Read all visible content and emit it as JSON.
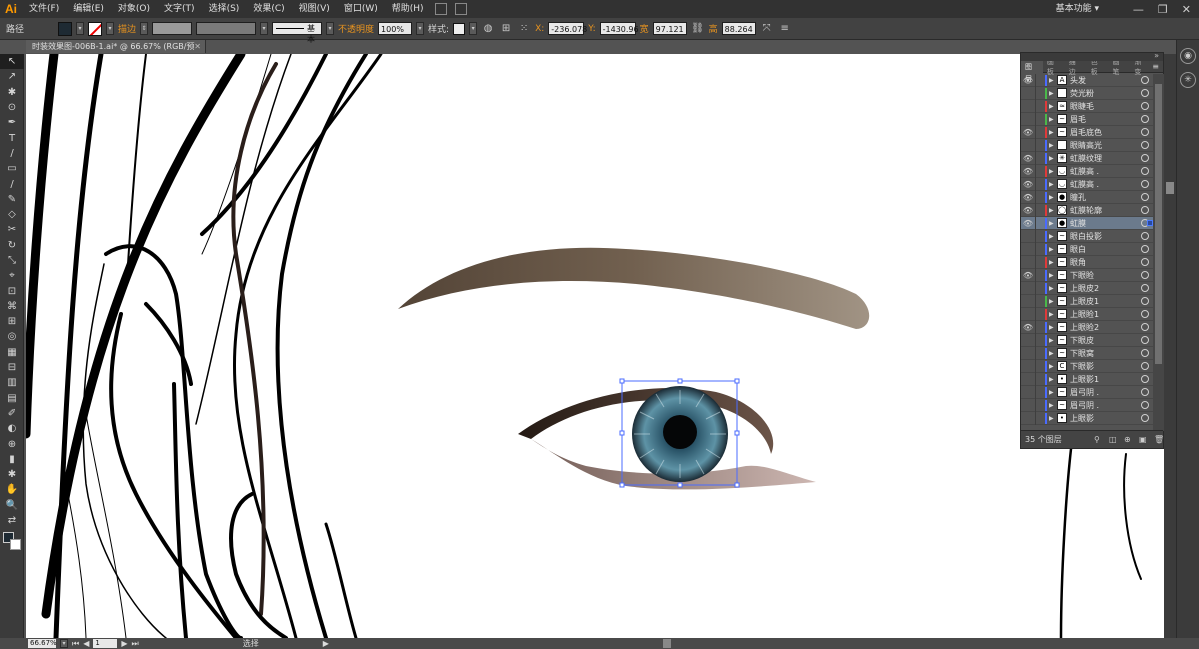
{
  "app": {
    "logo": "Ai",
    "workspace": "基本功能 ▾"
  },
  "menu": [
    "文件(F)",
    "编辑(E)",
    "对象(O)",
    "文字(T)",
    "选择(S)",
    "效果(C)",
    "视图(V)",
    "窗口(W)",
    "帮助(H)"
  ],
  "window_buttons": [
    "—",
    "❐",
    "✕"
  ],
  "control": {
    "path_label": "路径",
    "stroke_label": "描边",
    "stroke_style": "基本",
    "opacity_label": "不透明度",
    "opacity_value": "100%",
    "style_label": "样式:",
    "x_label": "X:",
    "x_value": "-236.078",
    "y_label": "Y:",
    "y_value": "-1430.96",
    "w_label": "宽",
    "w_value": "97.121 ",
    "h_label": "高",
    "h_value": "88.264 "
  },
  "document_tab": {
    "title": "时装效果图-006B-1.ai* @ 66.67% (RGB/预览)",
    "close": "✕"
  },
  "tools": [
    "↖",
    "↗",
    "✱",
    "⊙",
    "✒",
    "T",
    "/",
    "▭",
    "/",
    "✎",
    "◇",
    "✂",
    "↻",
    "⤡",
    "⌖",
    "⊡",
    "⌘",
    "⊞",
    "◎",
    "▦",
    "⊟",
    "▥",
    "▤",
    "✐",
    "◐",
    "⊕",
    "▮",
    "✱",
    "✋",
    "🔍",
    "⇄"
  ],
  "layers": {
    "tabs": [
      "图层",
      "画板",
      "描边",
      "色板",
      "画笔",
      "渐变"
    ],
    "menu_icon": "≡",
    "rows": [
      {
        "name": "头发",
        "eye": true,
        "color": "#4a6bff",
        "thumb": "A"
      },
      {
        "name": "荧光粉",
        "eye": false,
        "color": "#4ab84a",
        "thumb": ""
      },
      {
        "name": "眼睫毛",
        "eye": false,
        "color": "#e03a3a",
        "thumb": "≈"
      },
      {
        "name": "眉毛",
        "eye": false,
        "color": "#4ab84a",
        "thumb": "~"
      },
      {
        "name": "眉毛底色",
        "eye": true,
        "color": "#e03a3a",
        "thumb": "~"
      },
      {
        "name": "眼睛高光",
        "eye": false,
        "color": "#4a6bff",
        "thumb": ""
      },
      {
        "name": "虹膜纹理",
        "eye": true,
        "color": "#4a6bff",
        "thumb": "✳"
      },
      {
        "name": "虹膜高 .",
        "eye": true,
        "color": "#e03a3a",
        "thumb": "◡"
      },
      {
        "name": "虹膜高 .",
        "eye": true,
        "color": "#4a6bff",
        "thumb": "◡"
      },
      {
        "name": "瞳孔",
        "eye": true,
        "color": "#4a6bff",
        "thumb": "●"
      },
      {
        "name": "虹膜轮廓",
        "eye": true,
        "color": "#e03a3a",
        "thumb": "◯"
      },
      {
        "name": "虹膜",
        "eye": true,
        "color": "#4a6bff",
        "thumb": "●",
        "selected": true
      },
      {
        "name": "眼白投影",
        "eye": false,
        "color": "#4a6bff",
        "thumb": "~"
      },
      {
        "name": "眼白",
        "eye": false,
        "color": "#4a6bff",
        "thumb": "~"
      },
      {
        "name": "眼角",
        "eye": false,
        "color": "#e03a3a",
        "thumb": "~"
      },
      {
        "name": "下眼睑",
        "eye": true,
        "color": "#4a6bff",
        "thumb": "~"
      },
      {
        "name": "上眼皮2",
        "eye": false,
        "color": "#4a6bff",
        "thumb": "~"
      },
      {
        "name": "上眼皮1",
        "eye": false,
        "color": "#4ab84a",
        "thumb": "~"
      },
      {
        "name": "上眼睑1",
        "eye": false,
        "color": "#e03a3a",
        "thumb": "~"
      },
      {
        "name": "上眼睑2",
        "eye": true,
        "color": "#4a6bff",
        "thumb": "~"
      },
      {
        "name": "下眼皮",
        "eye": false,
        "color": "#4a6bff",
        "thumb": "~"
      },
      {
        "name": "下眼窝",
        "eye": false,
        "color": "#4a6bff",
        "thumb": "~"
      },
      {
        "name": "下眼影",
        "eye": false,
        "color": "#4a6bff",
        "thumb": "C"
      },
      {
        "name": "上眼影1",
        "eye": false,
        "color": "#4a6bff",
        "thumb": "•"
      },
      {
        "name": "眉弓阴 .",
        "eye": false,
        "color": "#4a6bff",
        "thumb": "~"
      },
      {
        "name": "眉弓阴 .",
        "eye": false,
        "color": "#4a6bff",
        "thumb": "~"
      },
      {
        "name": "上眼影",
        "eye": false,
        "color": "#4a6bff",
        "thumb": "•"
      }
    ],
    "footer_count": "35 个图层"
  },
  "status": {
    "zoom": "66.67%",
    "page": "1",
    "tool": "选择"
  }
}
